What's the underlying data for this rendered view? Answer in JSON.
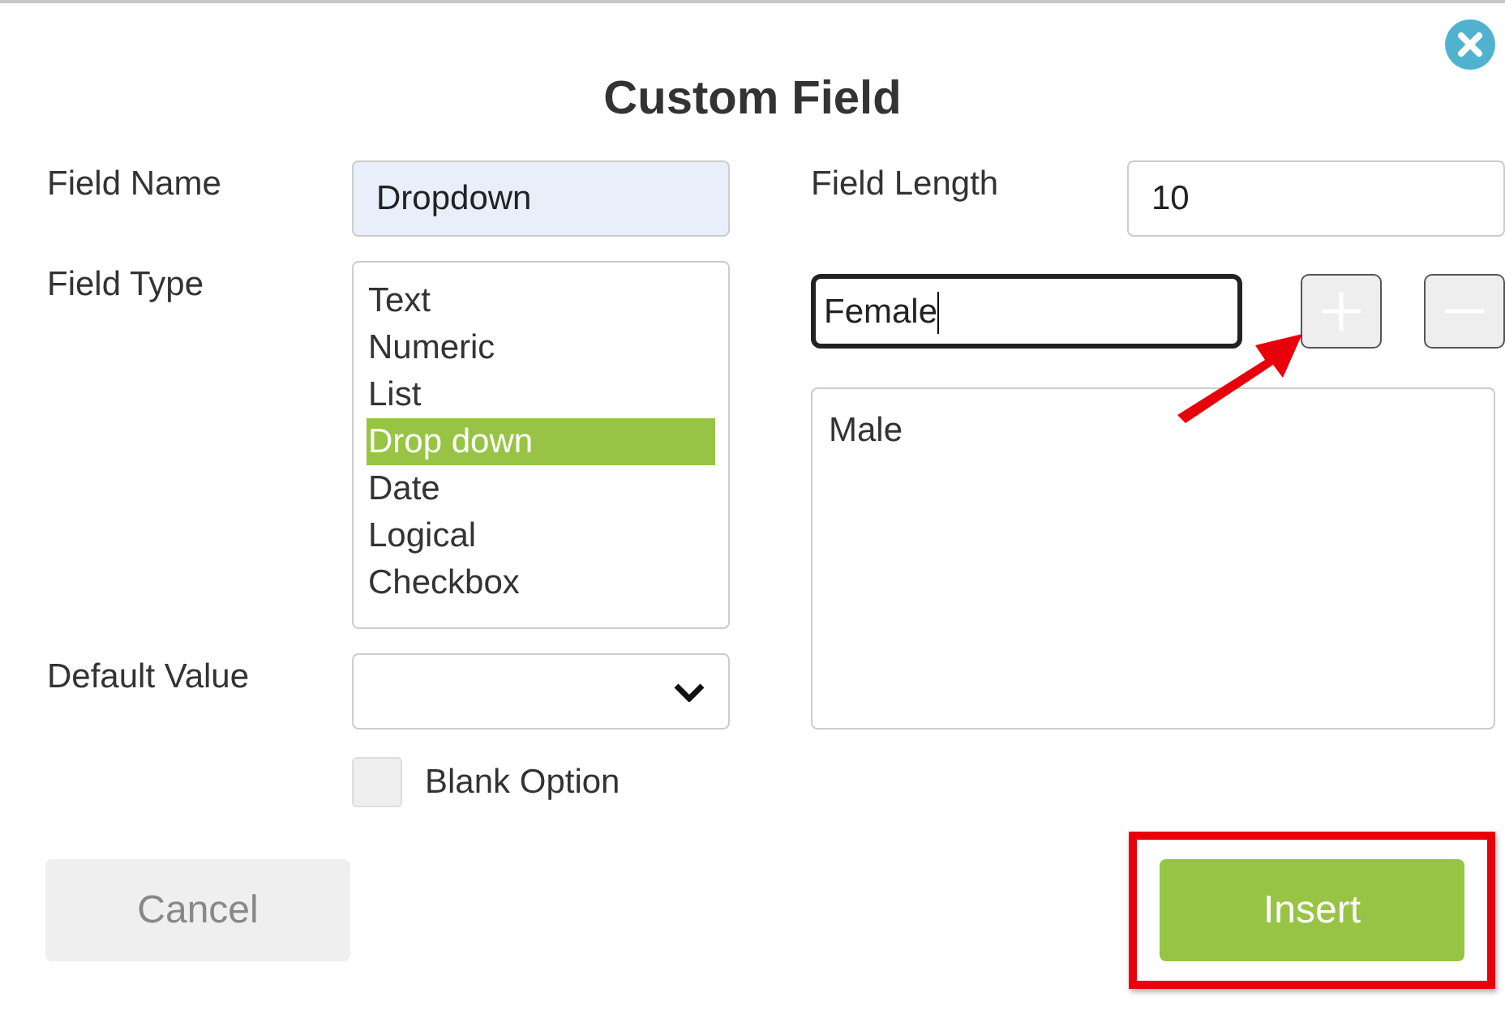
{
  "dialog": {
    "title": "Custom Field"
  },
  "field_name": {
    "label": "Field Name",
    "value": "Dropdown"
  },
  "field_type": {
    "label": "Field Type",
    "options": [
      {
        "label": "Text",
        "selected": false
      },
      {
        "label": "Numeric",
        "selected": false
      },
      {
        "label": "List",
        "selected": false
      },
      {
        "label": "Drop down",
        "selected": true
      },
      {
        "label": "Date",
        "selected": false
      },
      {
        "label": "Logical",
        "selected": false
      },
      {
        "label": "Checkbox",
        "selected": false
      }
    ]
  },
  "default_value": {
    "label": "Default Value"
  },
  "blank_option": {
    "label": "Blank Option",
    "checked": false
  },
  "field_length": {
    "label": "Field Length",
    "value": "10"
  },
  "option_entry": {
    "value": "Female",
    "focused": true
  },
  "option_values": [
    "Male"
  ],
  "buttons": [
    {
      "label": "Cancel",
      "kind": "secondary",
      "highlighted": false
    },
    {
      "label": "Insert",
      "kind": "primary",
      "highlighted": true
    }
  ]
}
